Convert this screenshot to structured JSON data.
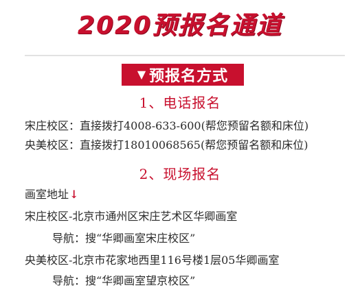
{
  "headline": "2020预报名通道",
  "banner": {
    "arrow": "▼",
    "label": "预报名方式"
  },
  "phone_section": {
    "title": "1、电话报名",
    "lines": [
      "宋庄校区：直接拨打4008-633-600(帮您预留名额和床位)",
      "央美校区：直接拨打18010068565(帮您预留名额和床位)"
    ]
  },
  "onsite_section": {
    "title": "2、现场报名",
    "address_label": "画室地址",
    "address_arrow": "↓",
    "campuses": [
      {
        "address": "宋庄校区-北京市通州区宋庄艺术区华卿画室",
        "navigation": "导航：搜“华卿画室宋庄校区”"
      },
      {
        "address": "央美校区-北京市花家地西里116号楼1层05华卿画室",
        "navigation": "导航：搜“华卿画室望京校区”"
      }
    ]
  },
  "colors": {
    "accent": "#c8102e",
    "text": "#2a2a2a",
    "divider": "#e2e2e2"
  }
}
